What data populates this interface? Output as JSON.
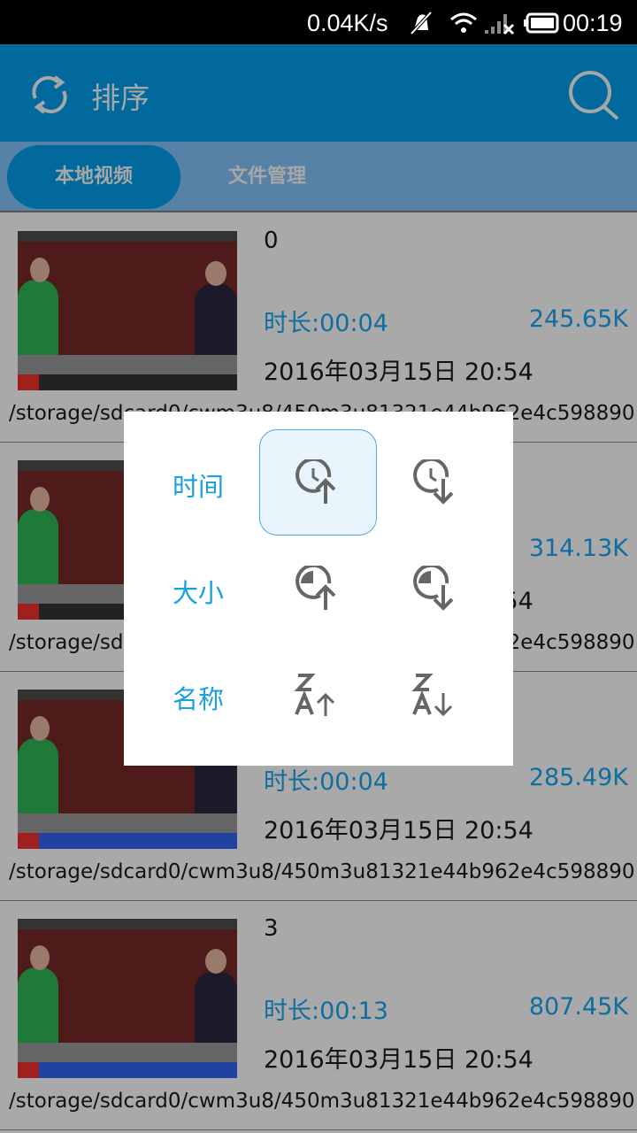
{
  "status_bar": {
    "speed": "0.04K/s",
    "time": "00:19"
  },
  "toolbar": {
    "title": "排序"
  },
  "tabs": [
    {
      "label": "本地视频",
      "active": true
    },
    {
      "label": "文件管理",
      "active": false
    }
  ],
  "videos": [
    {
      "title": "0",
      "duration": "时长:00:04",
      "size": "245.65K",
      "date": "2016年03月15日 20:54",
      "path": "/storage/sdcard0/cwm3u8/450m3u81321e44b962e4c598890..."
    },
    {
      "title": "",
      "duration": "",
      "size": "314.13K",
      "date": "2016年03月15日 20:54",
      "path": "/storage/sdcard0/cwm3u8/450m3u81321e44b962e4c598890..."
    },
    {
      "title": "",
      "duration": "时长:00:04",
      "size": "285.49K",
      "date": "2016年03月15日 20:54",
      "path": "/storage/sdcard0/cwm3u8/450m3u81321e44b962e4c598890..."
    },
    {
      "title": "3",
      "duration": "时长:00:13",
      "size": "807.45K",
      "date": "2016年03月15日 20:54",
      "path": "/storage/sdcard0/cwm3u8/450m3u81321e44b962e4c598890..."
    }
  ],
  "sort_dialog": {
    "rows": [
      {
        "label": "时间",
        "icons": [
          "time-ascending-icon",
          "time-descending-icon"
        ]
      },
      {
        "label": "大小",
        "icons": [
          "size-ascending-icon",
          "size-descending-icon"
        ]
      },
      {
        "label": "名称",
        "icons": [
          "name-ascending-icon",
          "name-descending-icon"
        ]
      }
    ],
    "selected": "time-ascending"
  },
  "colors": {
    "toolbar": "#01699b",
    "accent": "#1aa0dc",
    "selected_bg": "#e8f5fd"
  }
}
